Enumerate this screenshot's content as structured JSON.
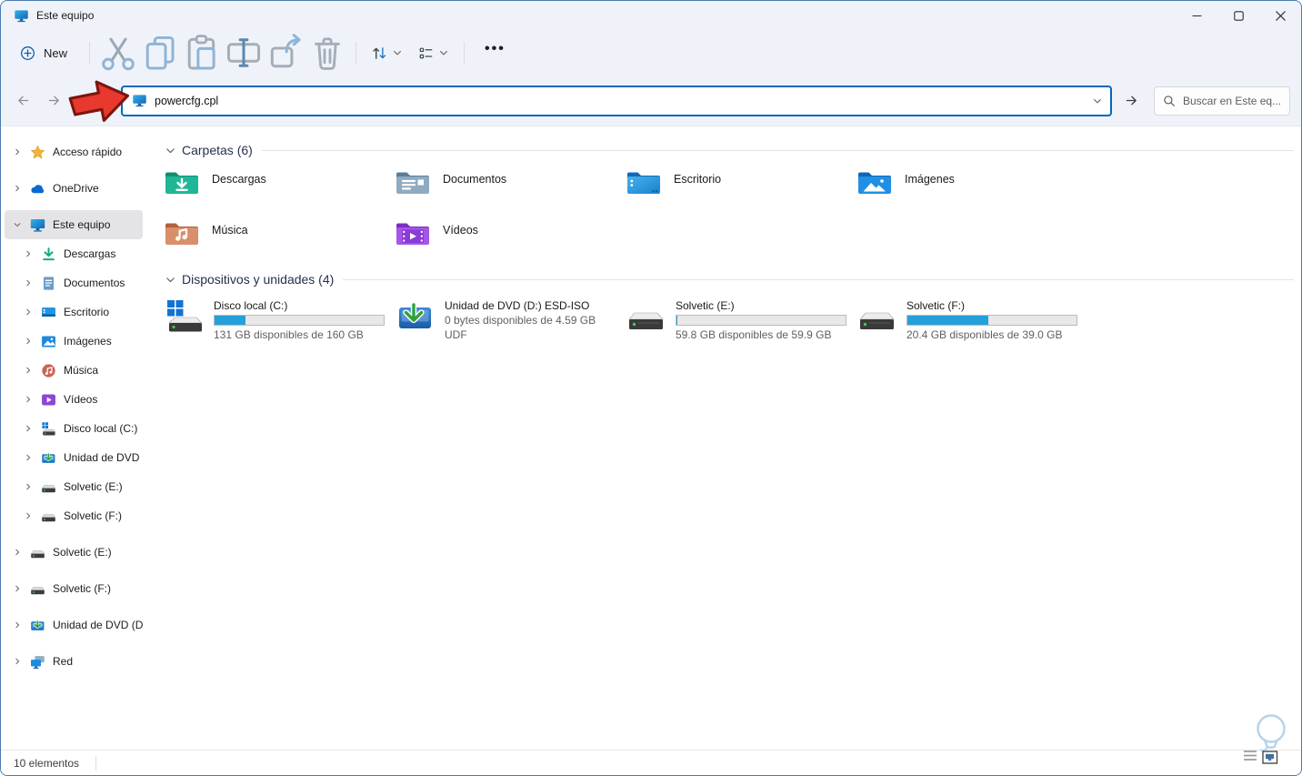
{
  "window": {
    "title": "Este equipo",
    "status": "10 elementos"
  },
  "toolbar": {
    "new_label": "New",
    "more_label": "•••"
  },
  "nav": {
    "address_value": "powercfg.cpl",
    "search_placeholder": "Buscar en Este eq..."
  },
  "sidebar": {
    "items": [
      {
        "label": "Acceso rápido"
      },
      {
        "label": "OneDrive"
      },
      {
        "label": "Este equipo"
      },
      {
        "label": "Descargas"
      },
      {
        "label": "Documentos"
      },
      {
        "label": "Escritorio"
      },
      {
        "label": "Imágenes"
      },
      {
        "label": "Música"
      },
      {
        "label": "Vídeos"
      },
      {
        "label": "Disco local (C:)"
      },
      {
        "label": "Unidad de DVD (D:"
      },
      {
        "label": "Solvetic (E:)"
      },
      {
        "label": "Solvetic (F:)"
      },
      {
        "label": "Solvetic (E:)"
      },
      {
        "label": "Solvetic (F:)"
      },
      {
        "label": "Unidad de DVD (D:)"
      },
      {
        "label": "Red"
      }
    ]
  },
  "main": {
    "sections": [
      {
        "title": "Carpetas (6)"
      },
      {
        "title": "Dispositivos y unidades (4)"
      }
    ],
    "folders": [
      {
        "label": "Descargas"
      },
      {
        "label": "Documentos"
      },
      {
        "label": "Escritorio"
      },
      {
        "label": "Imágenes"
      },
      {
        "label": "Música"
      },
      {
        "label": "Vídeos"
      }
    ],
    "drives": [
      {
        "name": "Disco local (C:)",
        "size": "131 GB disponibles de 160 GB",
        "used_percent": 18.1
      },
      {
        "name": "Unidad de DVD (D:) ESD-ISO",
        "line1": "0 bytes disponibles de 4.59 GB",
        "line2": "UDF"
      },
      {
        "name": "Solvetic (E:)",
        "size": "59.8 GB disponibles de 59.9 GB",
        "used_percent": 0.3
      },
      {
        "name": "Solvetic (F:)",
        "size": "20.4 GB disponibles de 39.0 GB",
        "used_percent": 47.7
      }
    ]
  },
  "colors": {
    "accent": "#0067c0",
    "bar_fill": "#26a0da",
    "annotation_arrow_red": "#e8392e"
  }
}
